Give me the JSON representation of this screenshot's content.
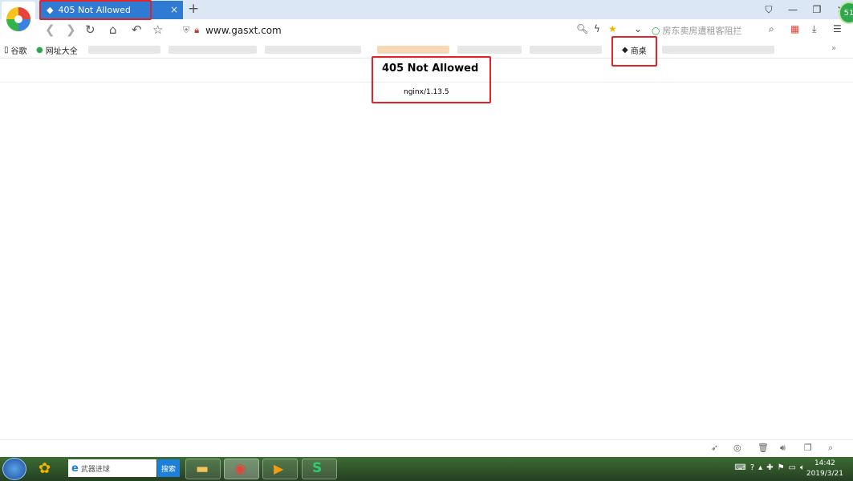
{
  "tab": {
    "title": "405 Not Allowed",
    "close": "×",
    "new_tab": "+"
  },
  "toolbar": {
    "url": "www.gasxt.com",
    "search_placeholder": "房东卖房遭租客阻拦"
  },
  "bookmarks": {
    "item1": "谷歌",
    "item2": "网址大全",
    "item3": "商桌"
  },
  "page": {
    "heading": "405 Not Allowed",
    "server": "nginx/1.13.5"
  },
  "user": {
    "badge": "51"
  },
  "taskbar": {
    "search_placeholder": "武器进球",
    "search_button": "搜索"
  },
  "clock": {
    "time": "14:42",
    "date": "2019/3/21"
  },
  "colors": {
    "tab_active": "#2f7bd3",
    "highlight": "#e0242a",
    "star": "#f4b400"
  }
}
